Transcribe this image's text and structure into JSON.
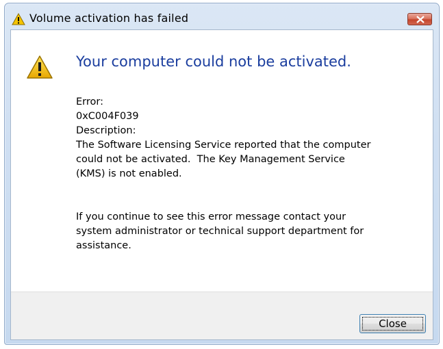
{
  "window": {
    "title": "Volume activation has failed",
    "title_icon": "warning-icon"
  },
  "titlebar": {
    "close_icon": "close-icon",
    "close_color": "#c4462d"
  },
  "dialog": {
    "icon": "warning-icon",
    "heading": "Your computer could not be activated.",
    "heading_color": "#1a3d9e",
    "error_label": "Error:",
    "error_code": "0xC004F039",
    "description_label": "Description:",
    "description_line1": "The Software Licensing Service reported that the computer",
    "description_line2": "could not be activated.  The Key Management Service",
    "description_line3": "(KMS) is not enabled.",
    "help_line1": "If you continue to see this error message contact your",
    "help_line2": "system administrator or technical support department for",
    "help_line3": "assistance."
  },
  "footer": {
    "close_button_label": "Close"
  }
}
